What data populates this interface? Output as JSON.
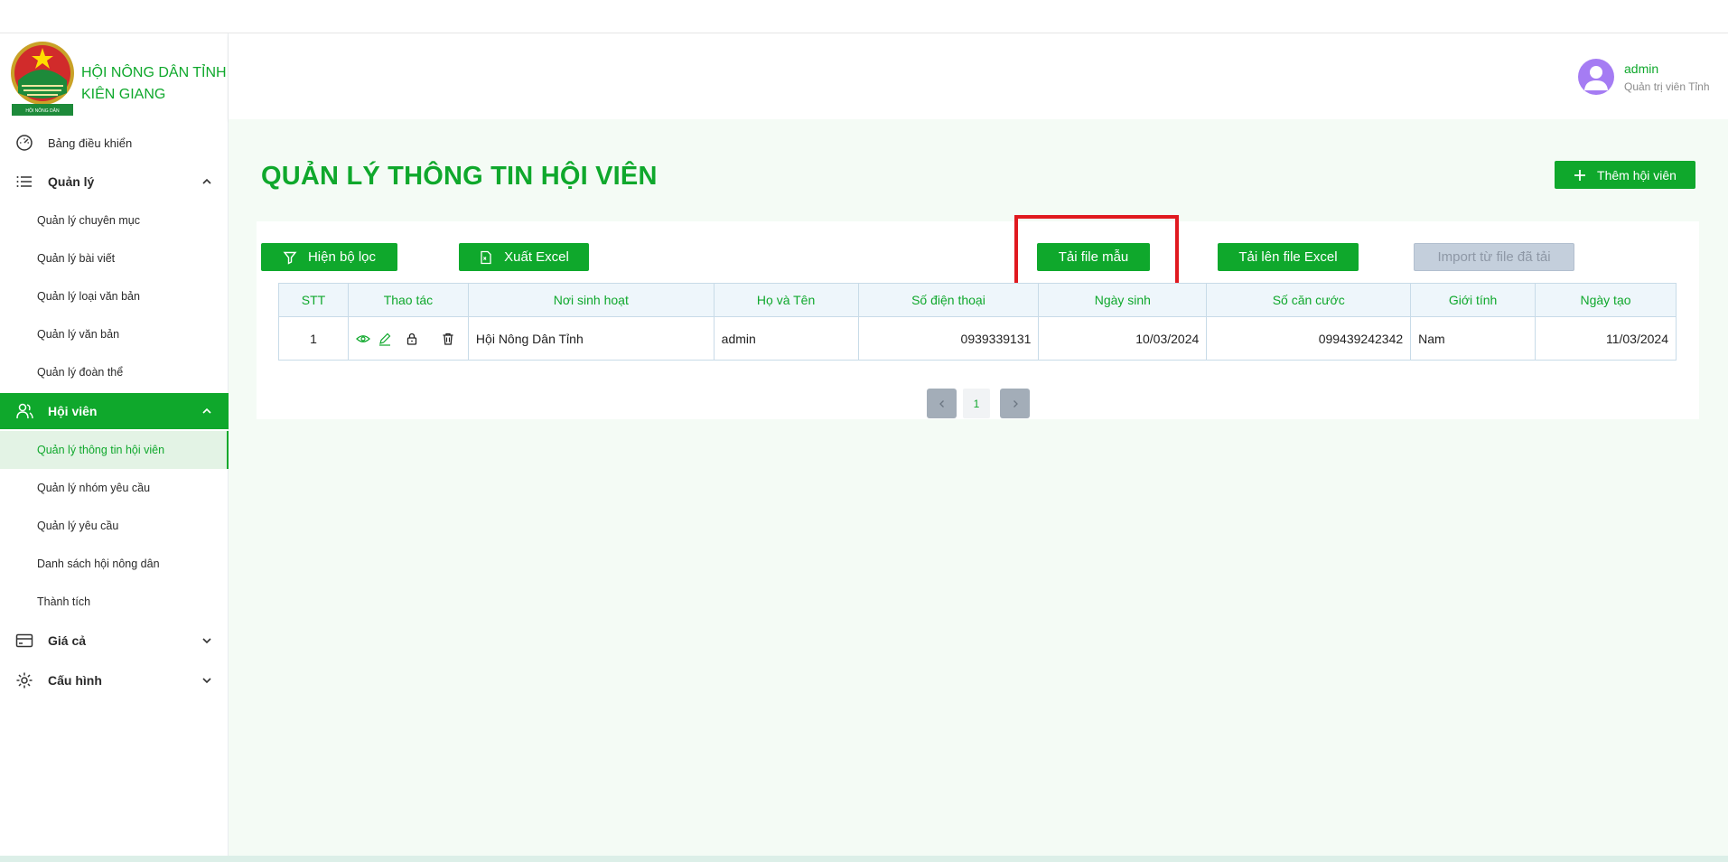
{
  "brand": {
    "line1": "HỘI NÔNG DÂN TỈNH",
    "line2": "KIÊN GIANG"
  },
  "sidebar": {
    "dashboard": "Bảng điều khiển",
    "manage": {
      "label": "Quản lý",
      "items": [
        "Quản lý chuyên mục",
        "Quản lý bài viết",
        "Quản lý loại văn bản",
        "Quản lý văn bản",
        "Quản lý đoàn thể"
      ]
    },
    "members": {
      "label": "Hội viên",
      "items": [
        "Quản lý thông tin hội viên",
        "Quản lý nhóm yêu cầu",
        "Quản lý yêu cầu",
        "Danh sách hội nông dân",
        "Thành tích"
      ]
    },
    "prices": "Giá cả",
    "config": "Cấu hình"
  },
  "user": {
    "name": "admin",
    "role": "Quản trị viên Tỉnh"
  },
  "page": {
    "title": "QUẢN LÝ THÔNG TIN HỘI VIÊN",
    "add_button": "Thêm hội viên"
  },
  "toolbar": {
    "filter": "Hiện bộ lọc",
    "export": "Xuất Excel",
    "template": "Tải file mẫu",
    "upload": "Tải lên file Excel",
    "import": "Import từ file đã tải"
  },
  "table": {
    "headers": [
      "STT",
      "Thao tác",
      "Nơi sinh hoạt",
      "Họ và Tên",
      "Số điện thoại",
      "Ngày sinh",
      "Số căn cước",
      "Giới tính",
      "Ngày tạo"
    ],
    "rows": [
      {
        "stt": "1",
        "place": "Hội Nông Dân Tỉnh",
        "name": "admin",
        "phone": "0939339131",
        "dob": "10/03/2024",
        "id_number": "099439242342",
        "gender": "Nam",
        "created": "11/03/2024"
      }
    ]
  },
  "pagination": {
    "current": "1"
  },
  "colors": {
    "accent": "#0fa82c",
    "highlight": "#e0191f",
    "avatar": "#a57cf3"
  }
}
